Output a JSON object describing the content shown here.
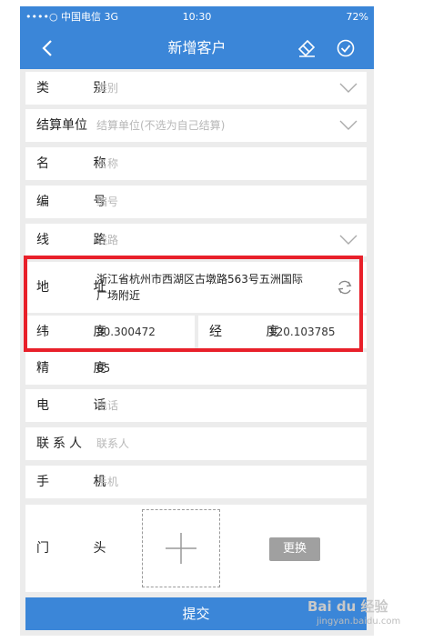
{
  "status": {
    "carrier": "••••○ 中国电信 3G",
    "time": "10:30",
    "battery": "72%"
  },
  "nav": {
    "title": "新增客户",
    "back_icon": "chevron-left-icon",
    "clear_icon": "eraser-icon",
    "confirm_icon": "check-circle-icon"
  },
  "form": {
    "category": {
      "label": "类 别",
      "placeholder": "类别"
    },
    "settlement": {
      "label": "结算单位",
      "placeholder": "结算单位(不选为自己结算)"
    },
    "name": {
      "label": "名 称",
      "placeholder": "名称"
    },
    "code": {
      "label": "编 号",
      "placeholder": "编号"
    },
    "route": {
      "label": "线 路",
      "placeholder": "线路"
    },
    "address": {
      "label": "地 址",
      "value": "浙江省杭州市西湖区古墩路563号五洲国际广场附近",
      "value_line1": "浙江省杭州市西湖区古墩路563号五洲国际",
      "value_line2": "广场附近"
    },
    "latitude": {
      "label": "纬 度",
      "value": "30.300472"
    },
    "longitude": {
      "label": "经 度",
      "value": "120.103785"
    },
    "accuracy": {
      "label": "精 度",
      "value": "65"
    },
    "phone": {
      "label": "电 话",
      "placeholder": "电话"
    },
    "contact": {
      "label": "联系人",
      "placeholder": "联系人"
    },
    "mobile": {
      "label": "手 机",
      "placeholder": "手机"
    },
    "storefront": {
      "label": "门 头",
      "swap_label": "更换"
    }
  },
  "submit_label": "提交",
  "watermark": {
    "brand": "Bai du 经验",
    "url": "jingyan.baidu.com"
  },
  "colors": {
    "primary": "#3b86d8",
    "highlight": "#e8202a",
    "background": "#ececec"
  }
}
